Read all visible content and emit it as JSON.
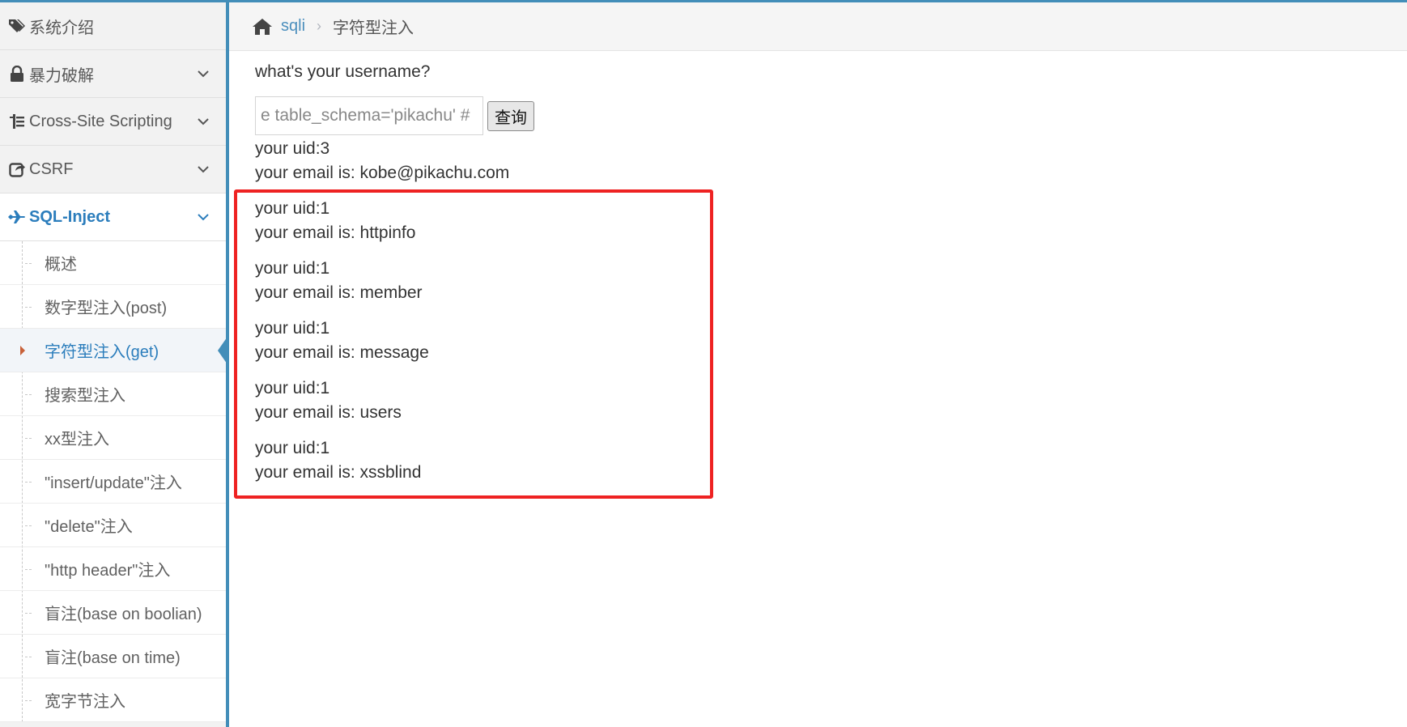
{
  "sidebar": {
    "items": [
      {
        "label": "系统介绍",
        "icon": "tags-icon",
        "has_chevron": false
      },
      {
        "label": "暴力破解",
        "icon": "lock-icon",
        "has_chevron": true
      },
      {
        "label": "Cross-Site Scripting",
        "icon": "sitemap-icon",
        "has_chevron": true
      },
      {
        "label": "CSRF",
        "icon": "share-square-icon",
        "has_chevron": true
      },
      {
        "label": "SQL-Inject",
        "icon": "plane-icon",
        "has_chevron": true,
        "active": true
      }
    ],
    "sql_submenu": [
      {
        "label": "概述"
      },
      {
        "label": "数字型注入(post)"
      },
      {
        "label": "字符型注入(get)",
        "active": true
      },
      {
        "label": "搜索型注入"
      },
      {
        "label": "xx型注入"
      },
      {
        "label": "\"insert/update\"注入"
      },
      {
        "label": "\"delete\"注入"
      },
      {
        "label": "\"http header\"注入"
      },
      {
        "label": "盲注(base on boolian)"
      },
      {
        "label": "盲注(base on time)"
      },
      {
        "label": "宽字节注入"
      }
    ]
  },
  "breadcrumb": {
    "home_icon": "home-icon",
    "link": "sqli",
    "current": "字符型注入"
  },
  "form": {
    "question": "what's your username?",
    "input_value": "e table_schema='pikachu' #",
    "button_label": "查询"
  },
  "results": {
    "first": {
      "uid": "your uid:3",
      "email": "your email is: kobe@pikachu.com"
    },
    "highlighted": [
      {
        "uid": "your uid:1",
        "email": "your email is: httpinfo"
      },
      {
        "uid": "your uid:1",
        "email": "your email is: member"
      },
      {
        "uid": "your uid:1",
        "email": "your email is: message"
      },
      {
        "uid": "your uid:1",
        "email": "your email is: users"
      },
      {
        "uid": "your uid:1",
        "email": "your email is: xssblind"
      }
    ]
  },
  "colors": {
    "accent": "#438eb9",
    "active_text": "#2b7dbc",
    "highlight_border": "#ee2222"
  }
}
